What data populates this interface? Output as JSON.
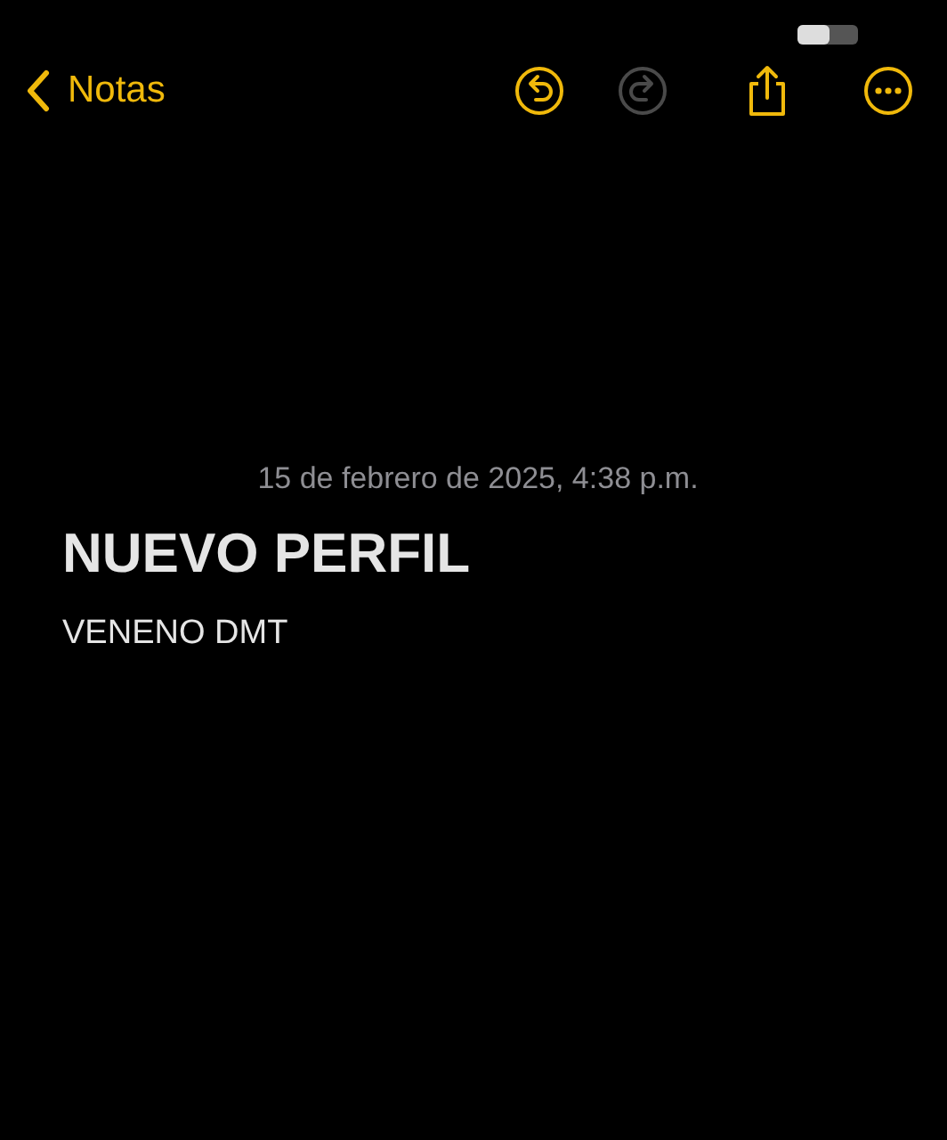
{
  "nav": {
    "back_label": "Notas",
    "actions": [
      {
        "kind": "undo",
        "disabled": false
      },
      {
        "kind": "redo",
        "disabled": true
      },
      {
        "kind": "share",
        "disabled": false
      },
      {
        "kind": "more",
        "disabled": false
      }
    ]
  },
  "note": {
    "date": "15 de febrero de 2025, 4:38 p.m.",
    "title": "NUEVO PERFIL",
    "body": "VENENO DMT"
  }
}
